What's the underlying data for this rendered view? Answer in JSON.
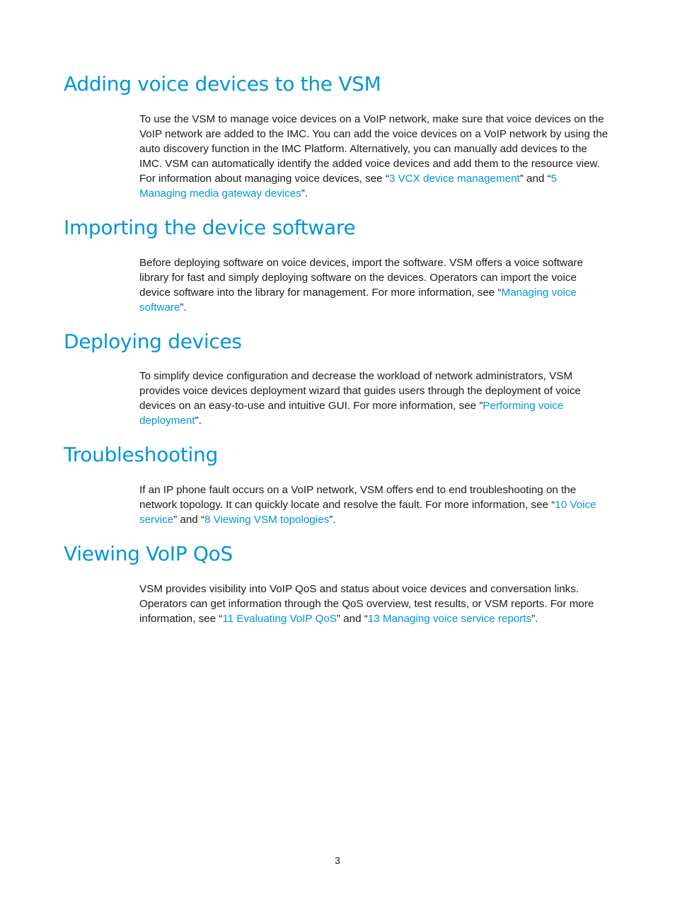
{
  "colors": {
    "heading": "#0096d6",
    "link": "#0096d6",
    "text": "#1a1a1a"
  },
  "sections": [
    {
      "heading": "Adding voice devices to the VSM",
      "lines": [
        [
          {
            "t": "To use the VSM to manage voice devices on a VoIP network, make sure that voice devices on the"
          }
        ],
        [
          {
            "t": "VoIP network are added to the IMC. You can add the voice devices on a VoIP network by using the"
          }
        ],
        [
          {
            "t": "auto discovery function in the IMC Platform. Alternatively, you can manually add devices to the"
          }
        ],
        [
          {
            "t": "IMC. VSM can automatically identify the added voice devices and add them to the resource view."
          }
        ],
        [
          {
            "t": "For information about managing voice devices, see “"
          },
          {
            "t": "3 VCX device management",
            "link": true
          },
          {
            "t": "” and “"
          },
          {
            "t": "5",
            "link": true
          }
        ],
        [
          {
            "t": "Managing media gateway devices",
            "link": true
          },
          {
            "t": "”."
          }
        ]
      ]
    },
    {
      "heading": "Importing the device software",
      "lines": [
        [
          {
            "t": "Before deploying software on voice devices, import the software. VSM offers a voice software"
          }
        ],
        [
          {
            "t": "library for fast and simply deploying software on the devices. Operators can import the voice"
          }
        ],
        [
          {
            "t": "device software into the library for management. For more information, see “"
          },
          {
            "t": "Managing voice",
            "link": true
          }
        ],
        [
          {
            "t": "software",
            "link": true
          },
          {
            "t": "”."
          }
        ]
      ]
    },
    {
      "heading": "Deploying devices",
      "lines": [
        [
          {
            "t": "To simplify device configuration and decrease the workload of network administrators, VSM"
          }
        ],
        [
          {
            "t": "provides voice devices deployment wizard that guides users through the deployment of voice"
          }
        ],
        [
          {
            "t": "devices on an easy-to-use and intuitive GUI. For more information, see ”"
          },
          {
            "t": "Performing voice",
            "link": true
          }
        ],
        [
          {
            "t": "deployment",
            "link": true
          },
          {
            "t": "”."
          }
        ]
      ]
    },
    {
      "heading": "Troubleshooting",
      "lines": [
        [
          {
            "t": "If an IP phone fault occurs on a VoIP network, VSM offers end to end troubleshooting on the"
          }
        ],
        [
          {
            "t": "network topology. It can quickly locate and resolve the fault. For more information, see “"
          },
          {
            "t": "10 Voice",
            "link": true
          }
        ],
        [
          {
            "t": "service",
            "link": true
          },
          {
            "t": "” and “"
          },
          {
            "t": "8 Viewing VSM topologies",
            "link": true
          },
          {
            "t": "”."
          }
        ]
      ]
    },
    {
      "heading": "Viewing VoIP QoS",
      "lines": [
        [
          {
            "t": "VSM provides visibility into VoIP QoS and status about voice devices and conversation links."
          }
        ],
        [
          {
            "t": "Operators can get information through the QoS overview, test results, or VSM reports. For more"
          }
        ],
        [
          {
            "t": "information, see “"
          },
          {
            "t": "11 Evaluating VoIP QoS",
            "link": true
          },
          {
            "t": "” and “"
          },
          {
            "t": "13 Managing voice service reports",
            "link": true
          },
          {
            "t": "”."
          }
        ]
      ]
    }
  ],
  "page_number": "3"
}
